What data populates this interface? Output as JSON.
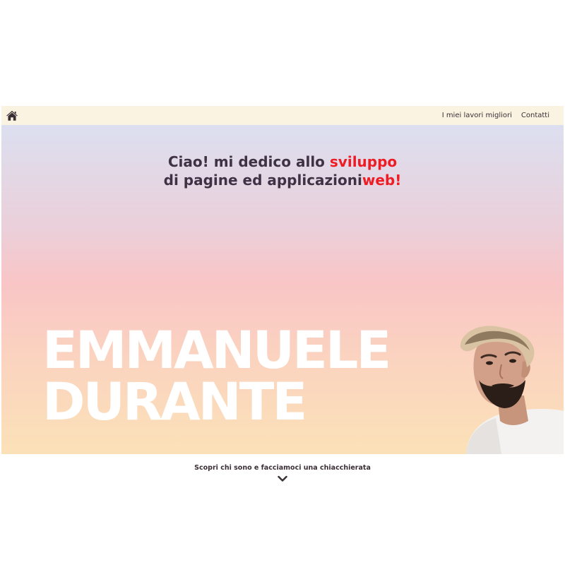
{
  "navbar": {
    "home_icon": "home-icon",
    "links": [
      "I miei lavori migliori",
      "Contatti"
    ]
  },
  "hero": {
    "tagline": {
      "line1_part1": "Ciao! mi dedico allo ",
      "line1_highlight": "sviluppo",
      "line2_part1": "di pagine ed applicazioni",
      "line2_highlight": "web!"
    },
    "name": {
      "first": "EMMANUELE",
      "last": "DURANTE"
    }
  },
  "footer": {
    "cta": "Scopri chi sono e facciamoci una chiacchierata",
    "cta_icon": "chevron-down-icon"
  },
  "colors": {
    "navbar_bg": "#fbf3e2",
    "text_dark": "#3f3244",
    "accent": "#ee1c24",
    "gradient_top": "#dcdff0",
    "gradient_mid": "#f9c5c6",
    "gradient_bottom": "#fbe1b8"
  }
}
